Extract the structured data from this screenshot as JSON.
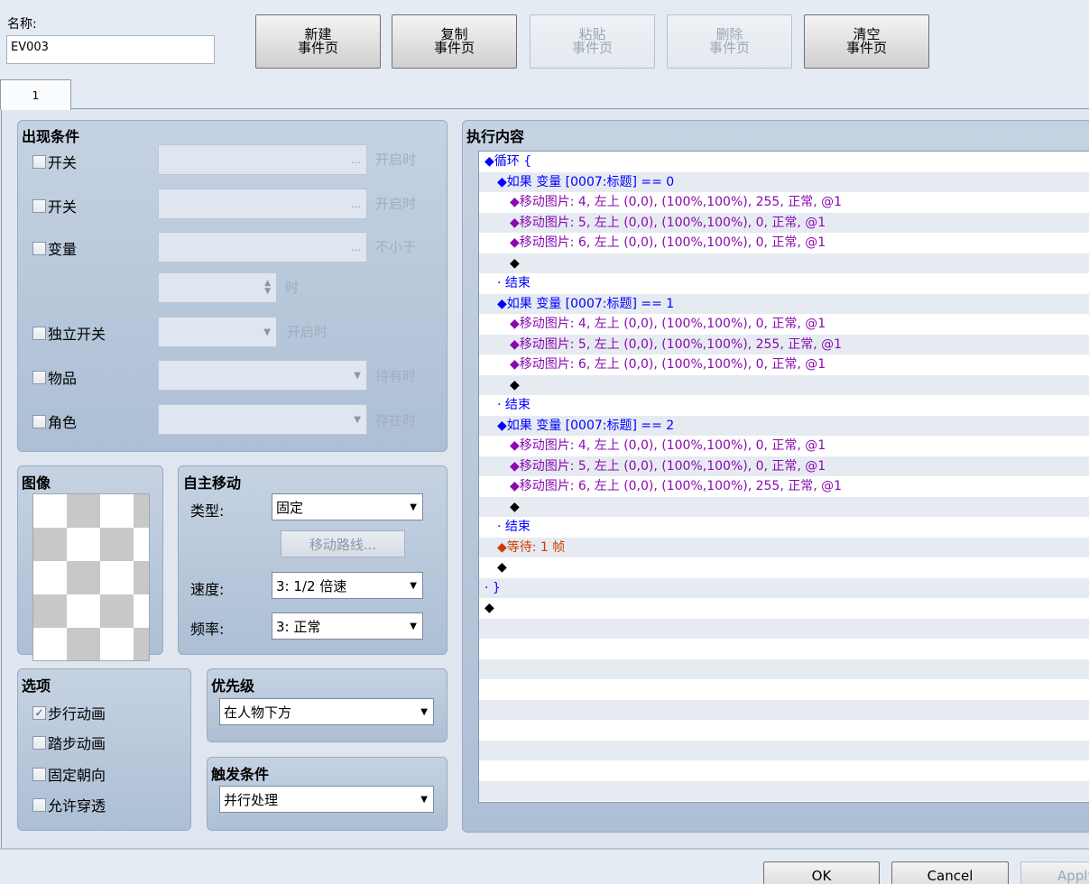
{
  "header": {
    "name_label": "名称:",
    "name_value": "EV003"
  },
  "buttons": {
    "new_page": "新建\n事件页",
    "copy_page": "复制\n事件页",
    "paste_page": "粘贴\n事件页",
    "delete_page": "删除\n事件页",
    "clear_page": "清空\n事件页"
  },
  "tabs": [
    {
      "label": "1"
    }
  ],
  "conditions": {
    "title": "出现条件",
    "switch1": {
      "label": "开关",
      "suffix": "开启时",
      "btn": "..."
    },
    "switch2": {
      "label": "开关",
      "suffix": "开启时",
      "btn": "..."
    },
    "variable": {
      "label": "变量",
      "suffix": "不小于",
      "btn": "...",
      "value_suffix": "时"
    },
    "self_switch": {
      "label": "独立开关",
      "suffix": "开启时"
    },
    "item": {
      "label": "物品",
      "suffix": "持有时"
    },
    "actor": {
      "label": "角色",
      "suffix": "存在时"
    }
  },
  "image": {
    "title": "图像"
  },
  "autonomous": {
    "title": "自主移动",
    "type_label": "类型:",
    "type_value": "固定",
    "route_button": "移动路线...",
    "speed_label": "速度:",
    "speed_value": "3: 1/2 倍速",
    "freq_label": "频率:",
    "freq_value": "3: 正常"
  },
  "options": {
    "title": "选项",
    "walking": {
      "label": "步行动画",
      "checked": "✓"
    },
    "stepping": {
      "label": "踏步动画",
      "checked": ""
    },
    "direction_fix": {
      "label": "固定朝向",
      "checked": ""
    },
    "through": {
      "label": "允许穿透",
      "checked": ""
    }
  },
  "priority": {
    "title": "优先级",
    "value": "在人物下方"
  },
  "trigger": {
    "title": "触发条件",
    "value": "并行处理"
  },
  "contents": {
    "title": "执行内容",
    "lines": [
      {
        "indent": 0,
        "color": "blue",
        "text": "◆循环 {"
      },
      {
        "indent": 1,
        "color": "blue",
        "text": "◆如果 变量 [0007:标题] == 0"
      },
      {
        "indent": 2,
        "color": "purple",
        "text": "◆移动图片: 4, 左上 (0,0), (100%,100%), 255, 正常, @1"
      },
      {
        "indent": 2,
        "color": "purple",
        "text": "◆移动图片: 5, 左上 (0,0), (100%,100%), 0, 正常, @1"
      },
      {
        "indent": 2,
        "color": "purple",
        "text": "◆移动图片: 6, 左上 (0,0), (100%,100%), 0, 正常, @1"
      },
      {
        "indent": 2,
        "color": "black",
        "text": "◆"
      },
      {
        "indent": 1,
        "color": "blue",
        "text": "· 结束"
      },
      {
        "indent": 1,
        "color": "blue",
        "text": "◆如果 变量 [0007:标题] == 1"
      },
      {
        "indent": 2,
        "color": "purple",
        "text": "◆移动图片: 4, 左上 (0,0), (100%,100%), 0, 正常, @1"
      },
      {
        "indent": 2,
        "color": "purple",
        "text": "◆移动图片: 5, 左上 (0,0), (100%,100%), 255, 正常, @1"
      },
      {
        "indent": 2,
        "color": "purple",
        "text": "◆移动图片: 6, 左上 (0,0), (100%,100%), 0, 正常, @1"
      },
      {
        "indent": 2,
        "color": "black",
        "text": "◆"
      },
      {
        "indent": 1,
        "color": "blue",
        "text": "· 结束"
      },
      {
        "indent": 1,
        "color": "blue",
        "text": "◆如果 变量 [0007:标题] == 2"
      },
      {
        "indent": 2,
        "color": "purple",
        "text": "◆移动图片: 4, 左上 (0,0), (100%,100%), 0, 正常, @1"
      },
      {
        "indent": 2,
        "color": "purple",
        "text": "◆移动图片: 5, 左上 (0,0), (100%,100%), 0, 正常, @1"
      },
      {
        "indent": 2,
        "color": "purple",
        "text": "◆移动图片: 6, 左上 (0,0), (100%,100%), 255, 正常, @1"
      },
      {
        "indent": 2,
        "color": "black",
        "text": "◆"
      },
      {
        "indent": 1,
        "color": "blue",
        "text": "· 结束"
      },
      {
        "indent": 1,
        "color": "orange",
        "text": "◆等待: 1 帧"
      },
      {
        "indent": 1,
        "color": "black",
        "text": "◆"
      },
      {
        "indent": 0,
        "color": "blue",
        "text": "· }"
      },
      {
        "indent": 0,
        "color": "black",
        "text": "◆"
      }
    ]
  },
  "footer": {
    "ok": "OK",
    "cancel": "Cancel",
    "apply": "Apply"
  }
}
